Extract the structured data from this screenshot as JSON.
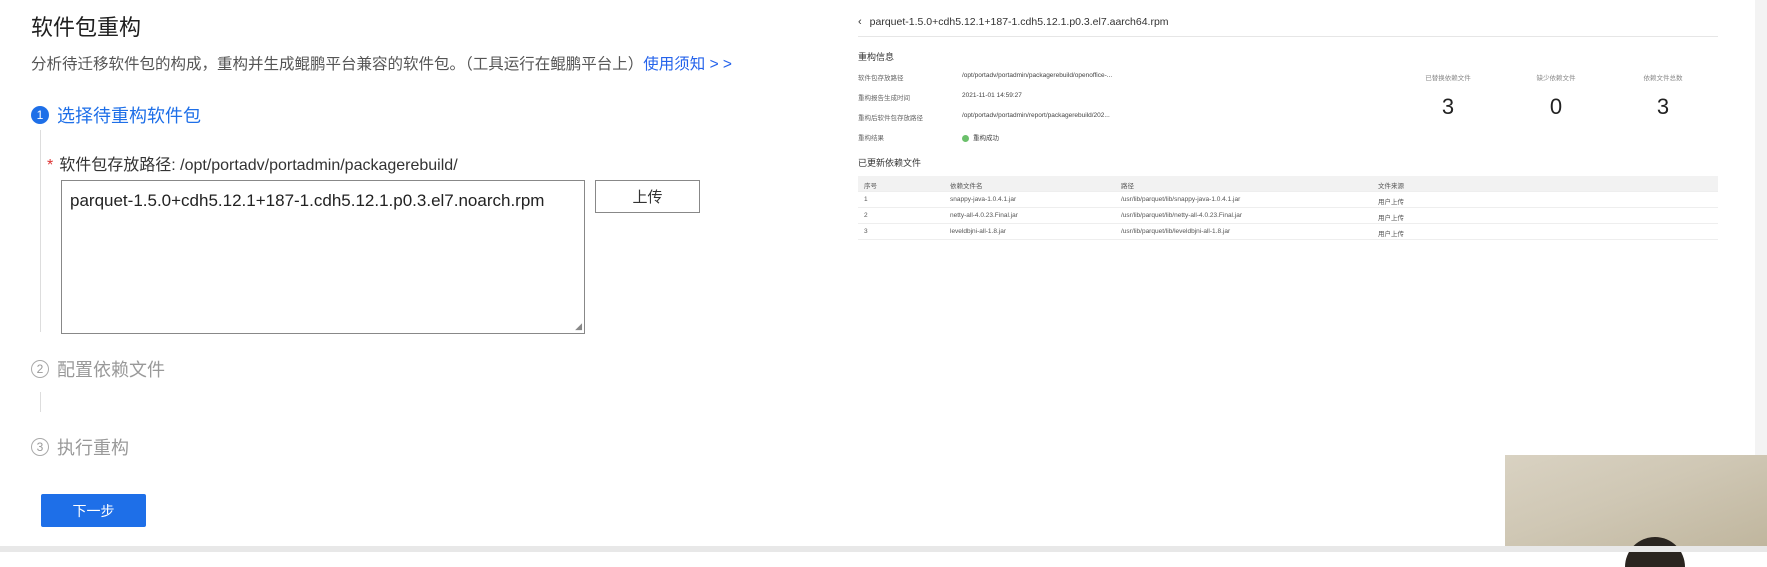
{
  "page": {
    "title": "软件包重构",
    "description": "分析待迁移软件包的构成，重构并生成鲲鹏平台兼容的软件包。（工具运行在鲲鹏平台上）",
    "help_link": "使用须知 > >"
  },
  "steps": [
    {
      "num": "1",
      "label": "选择待重构软件包",
      "state": "active"
    },
    {
      "num": "2",
      "label": "配置依赖文件",
      "state": "inactive"
    },
    {
      "num": "3",
      "label": "执行重构",
      "state": "inactive"
    }
  ],
  "package_path": {
    "required_mark": "*",
    "label": "软件包存放路径: /opt/portadv/portadmin/packagerebuild/",
    "value": "parquet-1.5.0+cdh5.12.1+187-1.cdh5.12.1.p0.3.el7.noarch.rpm"
  },
  "buttons": {
    "upload": "上传",
    "next": "下一步"
  },
  "report": {
    "title": "parquet-1.5.0+cdh5.12.1+187-1.cdh5.12.1.p0.3.el7.aarch64.rpm",
    "section_info": "重构信息",
    "info_rows": [
      {
        "label": "软件包存放路径",
        "value": "/opt/portadv/portadmin/packagerebuild/openoffice-..."
      },
      {
        "label": "重构报告生成时间",
        "value": "2021-11-01 14:59:27"
      },
      {
        "label": "重构后软件包存放路径",
        "value": "/opt/portadv/portadmin/report/packagerebuild/202..."
      },
      {
        "label": "重构结果",
        "value": "重构成功"
      }
    ],
    "stats": [
      {
        "label": "已替换依赖文件",
        "value": "3"
      },
      {
        "label": "缺少依赖文件",
        "value": "0"
      },
      {
        "label": "依赖文件总数",
        "value": "3"
      }
    ],
    "section_updated": "已更新依赖文件",
    "table_headers": [
      "序号",
      "依赖文件名",
      "路径",
      "文件来源"
    ],
    "table_rows": [
      [
        "1",
        "snappy-java-1.0.4.1.jar",
        "/usr/lib/parquet/lib/snappy-java-1.0.4.1.jar",
        "用户上传"
      ],
      [
        "2",
        "netty-all-4.0.23.Final.jar",
        "/usr/lib/parquet/lib/netty-all-4.0.23.Final.jar",
        "用户上传"
      ],
      [
        "3",
        "leveldbjni-all-1.8.jar",
        "/usr/lib/parquet/lib/leveldbjni-all-1.8.jar",
        "用户上传"
      ]
    ]
  },
  "colors": {
    "primary": "#1e6fe8",
    "link": "#2563eb",
    "required": "#dd3333",
    "success": "#6bc06b"
  }
}
